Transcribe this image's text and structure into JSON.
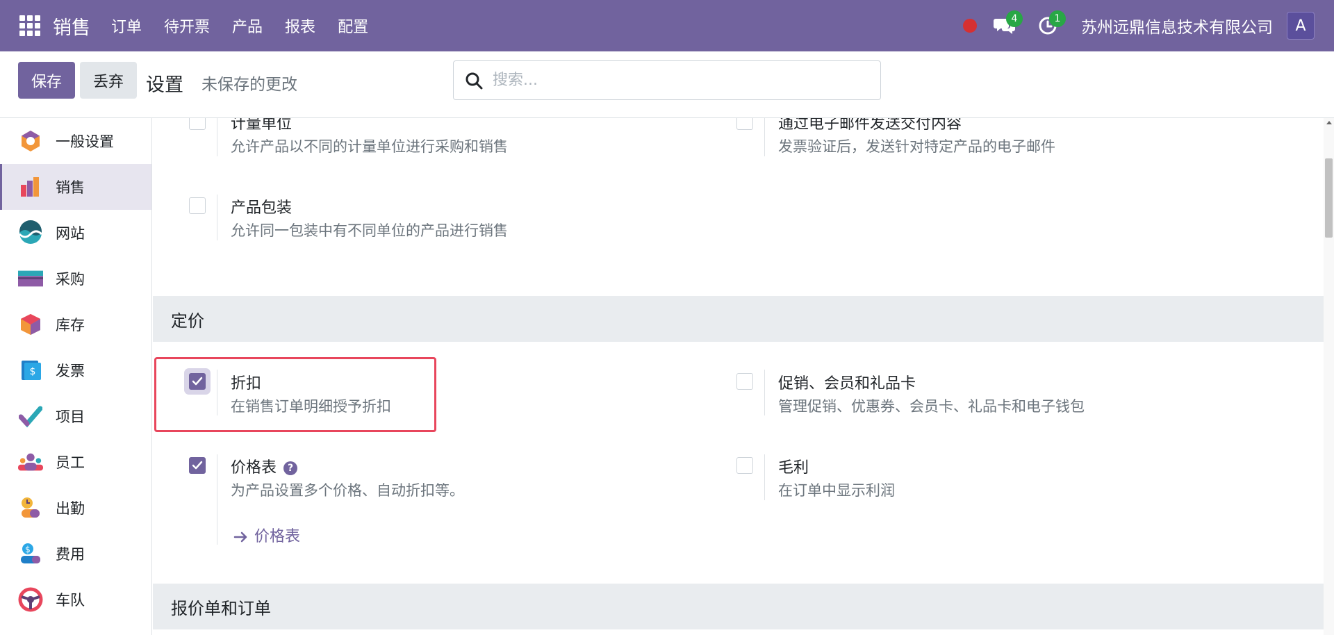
{
  "navbar": {
    "brand": "销售",
    "menu": [
      "订单",
      "待开票",
      "产品",
      "报表",
      "配置"
    ],
    "messages_count": "4",
    "activities_count": "1",
    "company": "苏州远鼎信息技术有限公司",
    "avatar_letter": "A",
    "bg_color": "#71639e"
  },
  "control_panel": {
    "save_label": "保存",
    "discard_label": "丢弃",
    "title": "设置",
    "status": "未保存的更改",
    "search_placeholder": "搜索..."
  },
  "sidebar": {
    "items": [
      {
        "label": "一般设置",
        "icon": "general-settings-icon"
      },
      {
        "label": "销售",
        "icon": "sales-icon",
        "active": true
      },
      {
        "label": "网站",
        "icon": "website-icon"
      },
      {
        "label": "采购",
        "icon": "purchase-icon"
      },
      {
        "label": "库存",
        "icon": "inventory-icon"
      },
      {
        "label": "发票",
        "icon": "invoicing-icon"
      },
      {
        "label": "项目",
        "icon": "project-icon"
      },
      {
        "label": "员工",
        "icon": "employees-icon"
      },
      {
        "label": "出勤",
        "icon": "attendance-icon"
      },
      {
        "label": "费用",
        "icon": "expenses-icon"
      },
      {
        "label": "车队",
        "icon": "fleet-icon"
      }
    ]
  },
  "settings": {
    "uom": {
      "title": "计量单位",
      "desc": "允许产品以不同的计量单位进行采购和销售",
      "checked": false
    },
    "email_delivery": {
      "title": "通过电子邮件发送交付内容",
      "desc": "发票验证后，发送针对特定产品的电子邮件",
      "checked": false
    },
    "packaging": {
      "title": "产品包装",
      "desc": "允许同一包装中有不同单位的产品进行销售",
      "checked": false
    },
    "pricing_section": "定价",
    "discount": {
      "title": "折扣",
      "desc": "在销售订单明细授予折扣",
      "checked": true
    },
    "promotions": {
      "title": "促销、会员和礼品卡",
      "desc": "管理促销、优惠券、会员卡、礼品卡和电子钱包",
      "checked": false
    },
    "pricelist": {
      "title": "价格表",
      "desc": "为产品设置多个价格、自动折扣等。",
      "checked": true,
      "link": "价格表",
      "help": "?"
    },
    "margins": {
      "title": "毛利",
      "desc": "在订单中显示利润",
      "checked": false
    },
    "quotations_section": "报价单和订单"
  }
}
